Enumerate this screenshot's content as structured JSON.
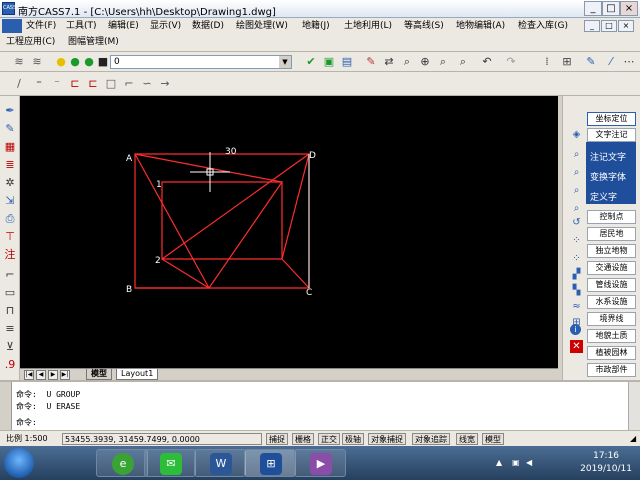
{
  "window": {
    "title": "南方CASS7.1 - [C:\\Users\\hh\\Desktop\\Drawing1.dwg]",
    "app_badge": "CASS",
    "buttons": [
      "_",
      "□",
      "×"
    ],
    "inner_buttons": [
      "_",
      "□",
      "×"
    ]
  },
  "menu": {
    "row1": [
      "文件(F)",
      "工具(T)",
      "编辑(E)",
      "显示(V)",
      "数据(D)",
      "绘图处理(W)",
      "地籍(J)",
      "土地利用(L)",
      "等高线(S)",
      "地物编辑(A)",
      "检查入库(G)"
    ],
    "row2": [
      "工程应用(C)",
      "图幅管理(M)"
    ]
  },
  "toolbar": {
    "layer_value": "0",
    "colors": {
      "accent": "#1f4f9a",
      "drawing": "#ff2d2d",
      "canvas": "#000000"
    }
  },
  "drawing": {
    "labels": {
      "A": "A",
      "B": "B",
      "C": "C",
      "D": "D",
      "p1": "1",
      "p2": "2",
      "dim": "30"
    }
  },
  "layout_tabs": {
    "model": "模型",
    "layout1": "Layout1"
  },
  "right_panel": {
    "top_button": "坐标定位",
    "items": [
      "文字注记",
      "",
      "",
      "",
      "",
      "",
      "控制点",
      "居民地",
      "独立地物",
      "交通设施",
      "管线设施",
      "水系设施",
      "境界线",
      "地貌土质",
      "植被园林",
      "市政部件"
    ],
    "flyout": [
      "注记文字",
      "变换字体",
      "定义字"
    ]
  },
  "command": {
    "lines": [
      "命令:  U GROUP",
      "命令:  U ERASE",
      "命令:"
    ]
  },
  "status": {
    "scale": "比例  1:500",
    "coords": "53455.3939, 31459.7499, 0.0000",
    "toggles": [
      "捕捉",
      "栅格",
      "正交",
      "极轴",
      "对象捕捉",
      "对象追踪",
      "线宽",
      "模型"
    ]
  },
  "taskbar": {
    "time": "17:16",
    "date": "2019/10/11"
  }
}
